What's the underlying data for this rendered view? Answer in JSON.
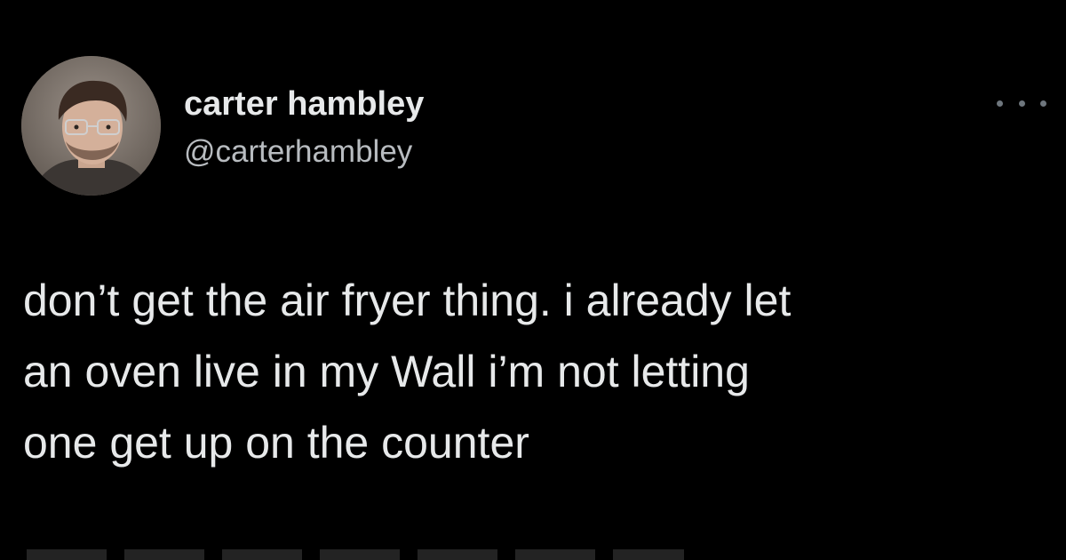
{
  "tweet": {
    "display_name": "carter hambley",
    "handle": "@carterhambley",
    "more_icon": "more-horizontal-icon",
    "text_lines": [
      "don’t get the air fryer thing. i already let",
      "an oven live in my Wall i’m not letting",
      "one get up on the counter"
    ]
  },
  "colors": {
    "background": "#000000",
    "text_primary": "#e7e9ea",
    "text_secondary": "#b8bcc0",
    "icon_muted": "#6e767d"
  }
}
